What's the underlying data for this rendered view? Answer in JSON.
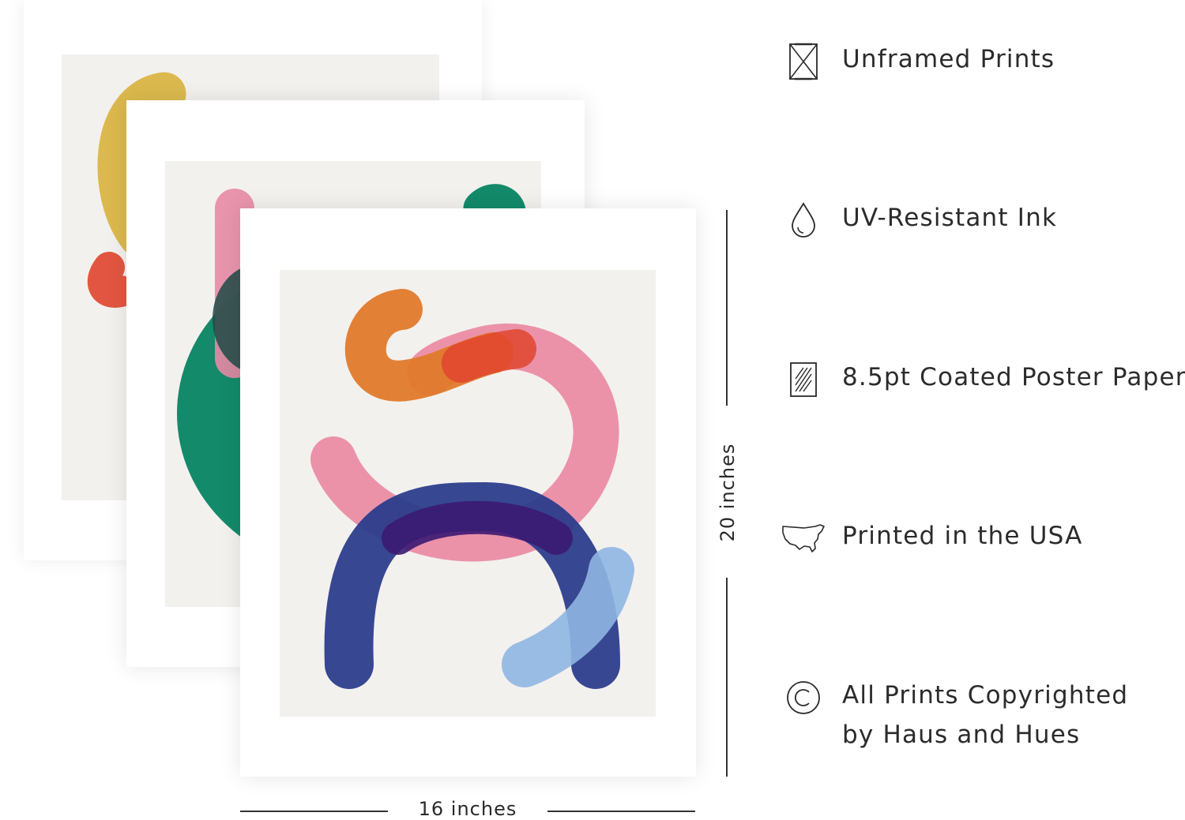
{
  "features": [
    {
      "icon": "unframed-icon",
      "label": "Unframed Prints"
    },
    {
      "icon": "ink-drop-icon",
      "label": "UV-Resistant Ink"
    },
    {
      "icon": "paper-icon",
      "label": "8.5pt Coated Poster Paper"
    },
    {
      "icon": "usa-map-icon",
      "label": "Printed in the USA"
    },
    {
      "icon": "copyright-icon",
      "label_line1": "All Prints Copyrighted",
      "label_line2": "by Haus and Hues"
    }
  ],
  "dimensions": {
    "width_label": "16 inches",
    "height_label": "20 inches"
  },
  "colors": {
    "orange": "#e07a2a",
    "pink": "#ea8aa3",
    "navy": "#2c3d8c",
    "light_blue": "#8fb6e2",
    "green": "#138a6a",
    "mustard": "#d9b23c",
    "red": "#e0452e",
    "paper_bg": "#f3f1ee"
  }
}
